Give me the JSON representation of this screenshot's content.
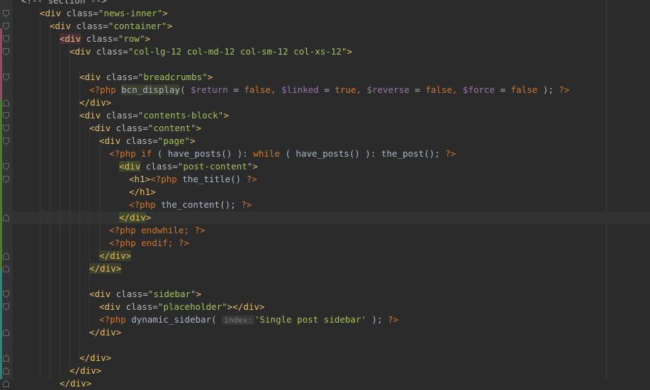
{
  "editor": {
    "lines": [
      {
        "indent": 0,
        "tokens": [
          {
            "t": "<!-- section -->",
            "c": "attr"
          }
        ]
      },
      {
        "indent": 56,
        "tokens": [
          {
            "t": "<div ",
            "c": "tag"
          },
          {
            "t": "class=",
            "c": "attr"
          },
          {
            "t": "\"news-inner\"",
            "c": "str"
          },
          {
            "t": ">",
            "c": "tag"
          }
        ]
      },
      {
        "indent": 70,
        "tokens": [
          {
            "t": "<div ",
            "c": "tag"
          },
          {
            "t": "class=",
            "c": "attr"
          },
          {
            "t": "\"container\"",
            "c": "str"
          },
          {
            "t": ">",
            "c": "tag"
          }
        ]
      },
      {
        "indent": 84,
        "tokens": [
          {
            "t": "<div",
            "c": "tag",
            "h": "hl-pink"
          },
          {
            "t": " class=",
            "c": "attr"
          },
          {
            "t": "\"row\"",
            "c": "str"
          },
          {
            "t": ">",
            "c": "tag"
          }
        ]
      },
      {
        "indent": 98,
        "tokens": [
          {
            "t": "<div ",
            "c": "tag"
          },
          {
            "t": "class=",
            "c": "attr"
          },
          {
            "t": "\"col-lg-12 col-md-12 col-sm-12 col-xs-12\"",
            "c": "str"
          },
          {
            "t": ">",
            "c": "tag"
          }
        ]
      },
      {
        "indent": 0,
        "tokens": []
      },
      {
        "indent": 112,
        "tokens": [
          {
            "t": "<div ",
            "c": "tag"
          },
          {
            "t": "class=",
            "c": "attr"
          },
          {
            "t": "\"breadcrumbs\"",
            "c": "str"
          },
          {
            "t": ">",
            "c": "tag"
          }
        ]
      },
      {
        "indent": 126,
        "tokens": [
          {
            "t": "<?php ",
            "c": "kw"
          },
          {
            "t": "bcn_display",
            "c": "fn",
            "h": "hl"
          },
          {
            "t": "( ",
            "c": "fn"
          },
          {
            "t": "$return",
            "c": "var"
          },
          {
            "t": " = ",
            "c": "fn"
          },
          {
            "t": "false",
            "c": "kw"
          },
          {
            "t": ", ",
            "c": "kw"
          },
          {
            "t": "$linked",
            "c": "var"
          },
          {
            "t": " = ",
            "c": "fn"
          },
          {
            "t": "true",
            "c": "kw"
          },
          {
            "t": ", ",
            "c": "kw"
          },
          {
            "t": "$reverse",
            "c": "var"
          },
          {
            "t": " = ",
            "c": "fn"
          },
          {
            "t": "false",
            "c": "kw"
          },
          {
            "t": ", ",
            "c": "kw"
          },
          {
            "t": "$force",
            "c": "var"
          },
          {
            "t": " = ",
            "c": "fn"
          },
          {
            "t": "false",
            "c": "kw"
          },
          {
            "t": " ); ",
            "c": "fn"
          },
          {
            "t": "?>",
            "c": "kw"
          }
        ]
      },
      {
        "indent": 112,
        "tokens": [
          {
            "t": "</div>",
            "c": "tag"
          }
        ]
      },
      {
        "indent": 112,
        "tokens": [
          {
            "t": "<div ",
            "c": "tag"
          },
          {
            "t": "class=",
            "c": "attr"
          },
          {
            "t": "\"contents-block\"",
            "c": "str"
          },
          {
            "t": ">",
            "c": "tag"
          }
        ]
      },
      {
        "indent": 126,
        "tokens": [
          {
            "t": "<div ",
            "c": "tag"
          },
          {
            "t": "class=",
            "c": "attr"
          },
          {
            "t": "\"content\"",
            "c": "str"
          },
          {
            "t": ">",
            "c": "tag"
          }
        ]
      },
      {
        "indent": 140,
        "tokens": [
          {
            "t": "<div ",
            "c": "tag"
          },
          {
            "t": "class=",
            "c": "attr"
          },
          {
            "t": "\"page\"",
            "c": "str"
          },
          {
            "t": ">",
            "c": "tag"
          }
        ]
      },
      {
        "indent": 154,
        "tokens": [
          {
            "t": "<?php ",
            "c": "kw"
          },
          {
            "t": "if",
            "c": "kw"
          },
          {
            "t": " ( have_posts() ): ",
            "c": "fn"
          },
          {
            "t": "while",
            "c": "kw"
          },
          {
            "t": " ( have_posts() ): the_post(); ",
            "c": "fn"
          },
          {
            "t": "?>",
            "c": "kw"
          }
        ]
      },
      {
        "indent": 168,
        "tokens": [
          {
            "t": "<div",
            "c": "tag",
            "h": "hl-match"
          },
          {
            "t": " class=",
            "c": "attr"
          },
          {
            "t": "\"post-content\"",
            "c": "str"
          },
          {
            "t": ">",
            "c": "tag"
          }
        ]
      },
      {
        "indent": 182,
        "tokens": [
          {
            "t": "<h1>",
            "c": "tag"
          },
          {
            "t": "<?php ",
            "c": "kw"
          },
          {
            "t": "the_title() ",
            "c": "fn"
          },
          {
            "t": "?>",
            "c": "kw"
          }
        ]
      },
      {
        "indent": 182,
        "tokens": [
          {
            "t": "</h1>",
            "c": "tag"
          }
        ]
      },
      {
        "indent": 182,
        "tokens": [
          {
            "t": "<?php ",
            "c": "kw"
          },
          {
            "t": "the_content(); ",
            "c": "fn"
          },
          {
            "t": "?>",
            "c": "kw"
          }
        ]
      },
      {
        "indent": 168,
        "tokens": [
          {
            "t": "</div",
            "c": "tag",
            "h": "hl-match"
          },
          {
            "t": ">",
            "c": "tag"
          }
        ]
      },
      {
        "indent": 154,
        "tokens": [
          {
            "t": "<?php ",
            "c": "kw"
          },
          {
            "t": "endwhile; ",
            "c": "kw"
          },
          {
            "t": "?>",
            "c": "kw"
          }
        ]
      },
      {
        "indent": 154,
        "tokens": [
          {
            "t": "<?php ",
            "c": "kw"
          },
          {
            "t": "endif; ",
            "c": "kw"
          },
          {
            "t": "?>",
            "c": "kw"
          }
        ]
      },
      {
        "indent": 140,
        "tokens": [
          {
            "t": "</div>",
            "c": "tag",
            "h": "hl"
          }
        ]
      },
      {
        "indent": 126,
        "tokens": [
          {
            "t": "</div>",
            "c": "tag",
            "h": "hl"
          }
        ]
      },
      {
        "indent": 0,
        "tokens": []
      },
      {
        "indent": 126,
        "tokens": [
          {
            "t": "<div ",
            "c": "tag"
          },
          {
            "t": "class=",
            "c": "attr"
          },
          {
            "t": "\"sidebar\"",
            "c": "str"
          },
          {
            "t": ">",
            "c": "tag"
          }
        ]
      },
      {
        "indent": 140,
        "tokens": [
          {
            "t": "<div ",
            "c": "tag"
          },
          {
            "t": "class=",
            "c": "attr"
          },
          {
            "t": "\"placeholder\"",
            "c": "str"
          },
          {
            "t": "></div>",
            "c": "tag"
          }
        ]
      },
      {
        "indent": 140,
        "tokens": [
          {
            "t": "<?php ",
            "c": "kw"
          },
          {
            "t": "dynamic_sidebar( ",
            "c": "fn"
          },
          {
            "t": "index:",
            "c": "hint"
          },
          {
            "t": "'Single post sidebar'",
            "c": "str"
          },
          {
            "t": " ); ",
            "c": "fn"
          },
          {
            "t": "?>",
            "c": "kw"
          }
        ]
      },
      {
        "indent": 126,
        "tokens": [
          {
            "t": "</div>",
            "c": "tag"
          }
        ]
      },
      {
        "indent": 0,
        "tokens": []
      },
      {
        "indent": 112,
        "tokens": [
          {
            "t": "</div>",
            "c": "tag"
          }
        ]
      },
      {
        "indent": 98,
        "tokens": [
          {
            "t": "</div>",
            "c": "tag"
          }
        ]
      },
      {
        "indent": 84,
        "tokens": [
          {
            "t": "</div>",
            "c": "tag"
          }
        ]
      }
    ],
    "current_line_index": 17,
    "colors": {
      "background": "#2b2b2b",
      "gutter": "#313335",
      "tag": "#e8bf6a",
      "attribute": "#bababa",
      "string": "#a5c25c",
      "keyword": "#cc7832",
      "variable": "#9876aa"
    }
  }
}
